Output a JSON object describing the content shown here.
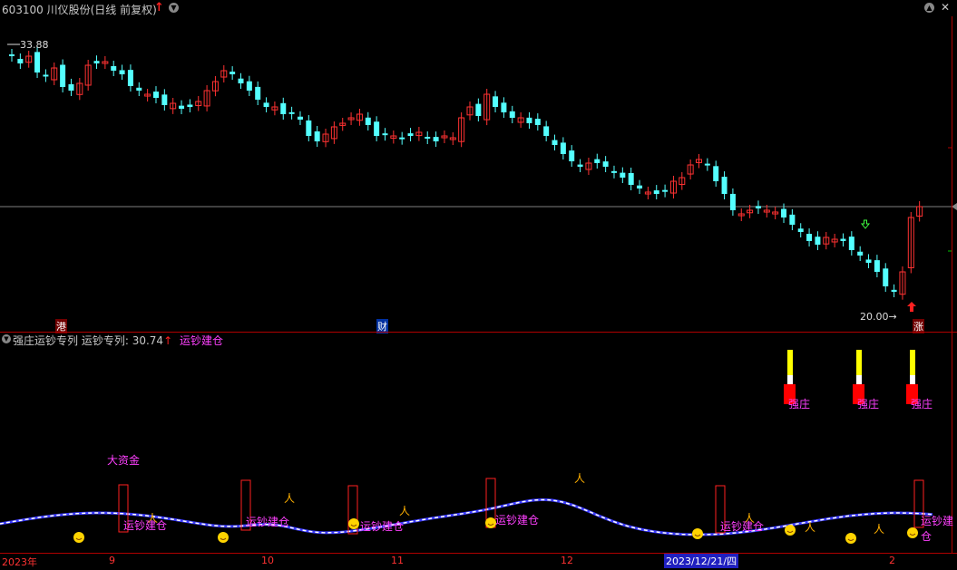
{
  "header": {
    "title": "603100 川仪股份(日线 前复权)",
    "arrow": "↑",
    "dropdown_icon": "chevron-down-icon",
    "close": "✕"
  },
  "main_chart": {
    "high_label": "33.88",
    "low_label": "20.00→",
    "event_markers": [
      "港",
      "财",
      "涨"
    ],
    "colors": {
      "up": "#ff3232",
      "down": "#54ffff",
      "ref_line": "#808080"
    }
  },
  "indicator": {
    "title": "强庄运钞专列",
    "value_label": "运钞专列: 30.74",
    "value_arrow": "↑",
    "legend": "运钞建仓",
    "big_fund_label": "大资金",
    "strong_label": "强庄",
    "build_label": "运钞建仓",
    "colors": {
      "label": "#ff40ff",
      "bar_yellow": "#ffff00",
      "bar_red": "#ff0000"
    }
  },
  "axis": {
    "labels": [
      "2023年",
      "9",
      "10",
      "11",
      "12",
      "2023/12/21/四",
      "2"
    ]
  }
}
